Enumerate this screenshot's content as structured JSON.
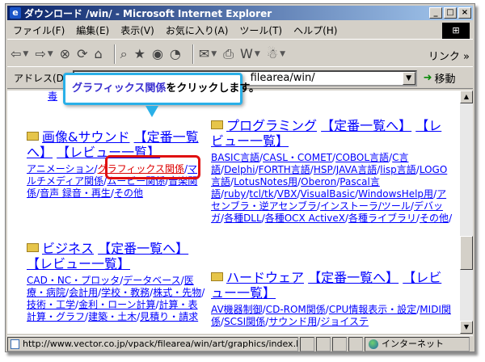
{
  "window": {
    "title": "ダウンロード /win/ - Microsoft Internet Explorer"
  },
  "menu": [
    "ファイル(F)",
    "編集(E)",
    "表示(V)",
    "お気に入り(A)",
    "ツール(T)",
    "ヘルプ(H)"
  ],
  "toolbar": {
    "links_label": "リンク »"
  },
  "address": {
    "label": "アドレス(D)",
    "value": "filearea/win/",
    "go_label": "移動"
  },
  "callout": {
    "highlight": "グラフィックス関係",
    "rest": "をクリックします。"
  },
  "content": {
    "top_cut_text": "毒",
    "col1": {
      "cat1": {
        "title": "画像&サウンド",
        "link": "【定番一覧へ】",
        "review": "【レビュー一覧】",
        "subs": [
          "アニメーション",
          "グラフィックス関係",
          "マルチメディア関係",
          "ムービー関係",
          "音楽関係",
          "音声 録音・再生",
          "その他"
        ]
      },
      "cat2": {
        "title": "ビジネス",
        "link": "【定番一覧へ】",
        "review": "【レビュー一覧】",
        "subs": [
          "CAD・NC・プロッタ",
          "データベース",
          "医療・病院",
          "会計用",
          "学校・教務",
          "株式・先物",
          "技術・工学",
          "金利・ローン計算",
          "計算・表計算・グラフ",
          "建築・土木",
          "見積り・請求"
        ]
      }
    },
    "col2": {
      "cat1": {
        "title": "プログラミング",
        "link": "【定番一覧へ】",
        "review": "【レビュー一覧】",
        "subs": [
          "BASIC言語",
          "CASL・COMET",
          "COBOL言語",
          "C言語",
          "Delphi",
          "FORTH言語",
          "HSP",
          "JAVA言語",
          "lisp言語",
          "LOGO言語",
          "LotusNotes用",
          "Oberon",
          "Pascal言語",
          "ruby",
          "tcl/tk",
          "VBX",
          "VisualBasic",
          "WindowsHelp用",
          "アセンブラ・逆アセンブラ",
          "インストーラ/ツール",
          "デバッガ",
          "各種DLL",
          "各種OCX ActiveX",
          "各種ライブラリ",
          "その他"
        ]
      },
      "cat2": {
        "title": "ハードウェア",
        "link": "【定番一覧へ】",
        "review": "【レビュー一覧】",
        "subs": [
          "AV機器制御",
          "CD-ROM関係",
          "CPU情報表示・設定",
          "MIDI関係",
          "SCSI関係",
          "サウンド用",
          "ジョイステ"
        ]
      }
    }
  },
  "status": {
    "url": "http://www.vector.co.jp/vpack/filearea/win/art/graphics/index.ht",
    "zone": "インターネット"
  }
}
